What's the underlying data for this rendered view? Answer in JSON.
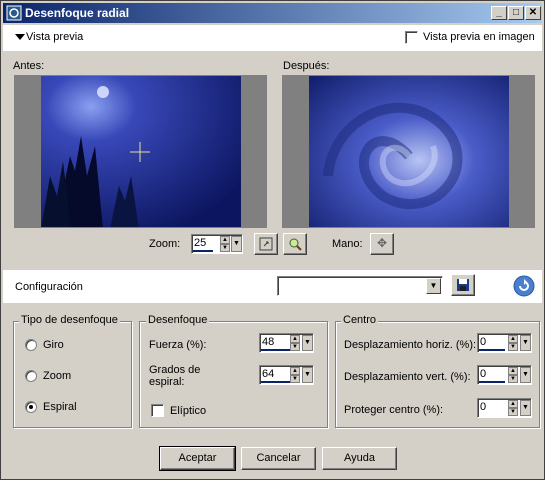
{
  "window": {
    "title": "Desenfoque radial",
    "min_symbol": "_",
    "max_symbol": "□",
    "close_symbol": "✕"
  },
  "preview": {
    "toggle_label": "Vista previa",
    "in_image_label": "Vista previa en imagen",
    "in_image_checked": false,
    "before_label": "Antes:",
    "after_label": "Después:",
    "zoom_label": "Zoom:",
    "zoom_value": "25",
    "pan_label": "Mano:"
  },
  "config": {
    "label": "Configuración",
    "selected": ""
  },
  "blur_type": {
    "title": "Tipo de desenfoque",
    "options": [
      {
        "label": "Giro",
        "selected": false
      },
      {
        "label": "Zoom",
        "selected": false
      },
      {
        "label": "Espiral",
        "selected": true
      }
    ]
  },
  "blur": {
    "title": "Desenfoque",
    "strength_label": "Fuerza (%):",
    "strength_value": "48",
    "spiral_label_1": "Grados de",
    "spiral_label_2": "espiral:",
    "spiral_value": "64",
    "elliptic_label": "Elíptico",
    "elliptic_checked": false
  },
  "center": {
    "title": "Centro",
    "h_offset_label": "Desplazamiento horiz. (%):",
    "h_offset_value": "0",
    "v_offset_label": "Desplazamiento vert. (%):",
    "v_offset_value": "0",
    "protect_label": "Proteger centro (%):",
    "protect_value": "0"
  },
  "buttons": {
    "ok": "Aceptar",
    "cancel": "Cancelar",
    "help": "Ayuda"
  },
  "colors": {
    "titlebar_start": "#0a246a",
    "titlebar_end": "#a6caf0",
    "dialog_bg": "#d4d0c8"
  }
}
